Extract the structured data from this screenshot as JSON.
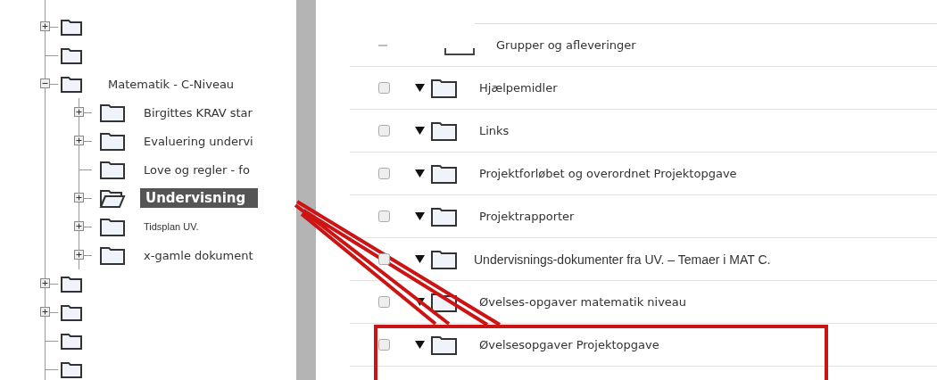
{
  "tree": [
    {
      "kind": "branch",
      "expanded": false
    },
    {
      "kind": "leaf"
    },
    {
      "label": "Matematik - C-Niveau",
      "kind": "branch",
      "expanded": true,
      "selected": false,
      "children": [
        {
          "label": "Birgittes KRAV star",
          "kind": "branch",
          "expanded": false,
          "selected": false
        },
        {
          "label": "Evaluering undervi",
          "kind": "branch",
          "expanded": false,
          "selected": false
        },
        {
          "label": "Love og regler - fo",
          "kind": "leaf",
          "selected": false
        },
        {
          "label": "Undervisning",
          "kind": "branch",
          "expanded": false,
          "selected": true
        },
        {
          "label": "Tidsplan UV.",
          "kind": "branch",
          "expanded": false,
          "selected": false
        },
        {
          "label": "x-gamle dokument",
          "kind": "branch",
          "expanded": false,
          "selected": false
        }
      ]
    },
    {
      "kind": "branch",
      "expanded": false
    },
    {
      "kind": "branch",
      "expanded": false
    },
    {
      "kind": "leaf"
    },
    {
      "kind": "leaf"
    }
  ],
  "folders": [
    {
      "name": "Grupper og afleveringer",
      "kind": "partial"
    },
    {
      "name": "Hjælpemidler",
      "kind": "item",
      "checked": false
    },
    {
      "name": "Links",
      "kind": "item",
      "checked": false
    },
    {
      "name": "Projektforløbet og overordnet Projektopgave",
      "kind": "item",
      "checked": false
    },
    {
      "name": "Projektrapporter",
      "kind": "item",
      "checked": false
    },
    {
      "name": "Undervisnings-dokumenter fra UV. – Temaer i MAT  C.",
      "kind": "item",
      "checked": false
    },
    {
      "name": "Øvelses-opgaver matematik niveau",
      "kind": "item",
      "checked": false
    },
    {
      "name": "Øvelsesopgaver Projektopgave",
      "kind": "item",
      "checked": false
    }
  ]
}
